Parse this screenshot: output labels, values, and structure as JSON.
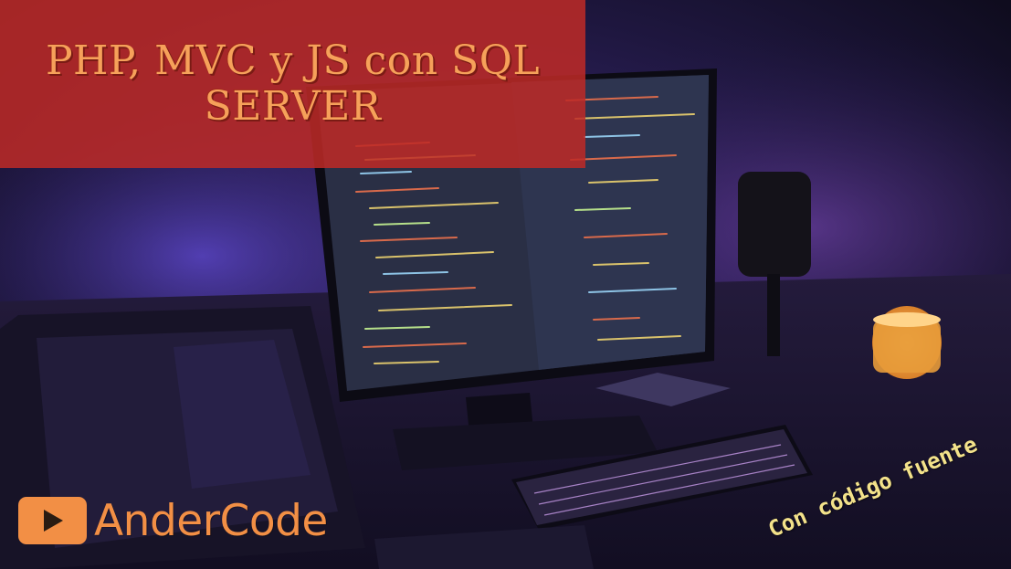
{
  "banner": {
    "title": "PHP, MVC y JS con SQL SERVER",
    "color": "#be2a26",
    "text_color": "#f6a15a"
  },
  "logo": {
    "brand": "AnderCode",
    "icon": "play-icon",
    "color": "#f28f45"
  },
  "tagline": {
    "text": "Con código fuente",
    "color": "#f3e28a"
  },
  "scene": {
    "subject": "desk with computer monitor showing code, keyboard, laptop, microphone, candle"
  }
}
